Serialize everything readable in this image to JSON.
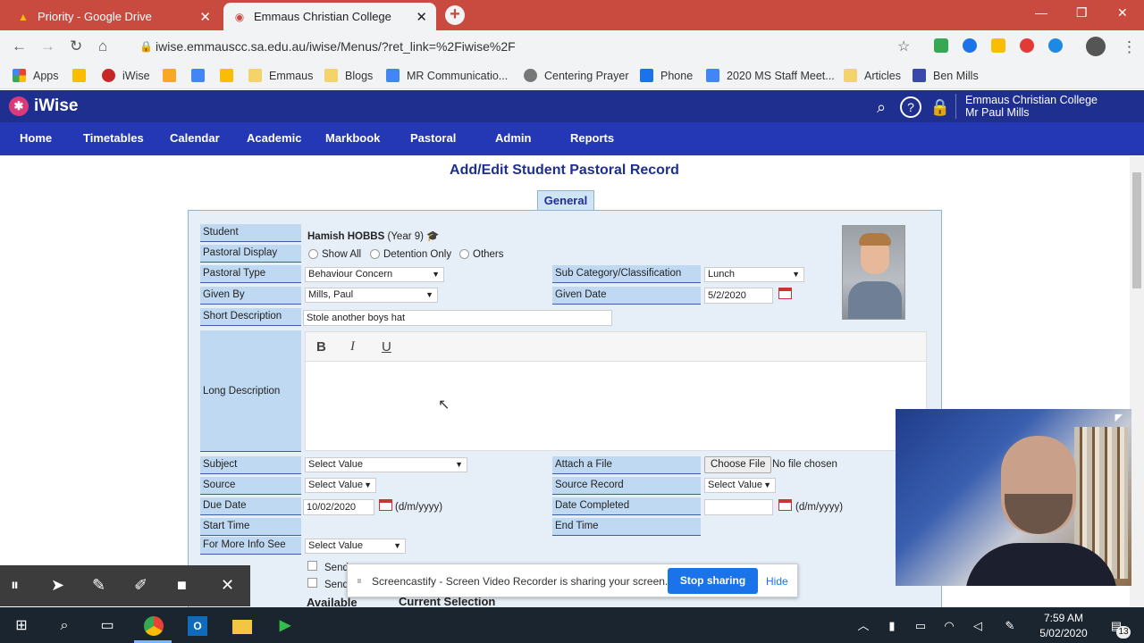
{
  "browser": {
    "tabs": [
      {
        "title": "Priority - Google Drive",
        "icon": "drive-icon"
      },
      {
        "title": "Emmaus Christian College",
        "icon": "globe-icon"
      }
    ],
    "url": "iwise.emmauscc.sa.edu.au/iwise/Menus/?ret_link=%2Fiwise%2F",
    "bookmarks": [
      "Apps",
      "",
      "iWise",
      "",
      "",
      "",
      "Emmaus",
      "Blogs",
      "MR Communicatio...",
      "Centering Prayer",
      "Phone",
      "2020 MS Staff Meet...",
      "Articles",
      "Ben Mills"
    ]
  },
  "app": {
    "logo": "iWise",
    "school": "Emmaus Christian College",
    "user": "Mr Paul Mills",
    "menu": [
      "Home",
      "Timetables",
      "Calendar",
      "Academic",
      "Markbook",
      "Pastoral",
      "Admin",
      "Reports"
    ]
  },
  "page": {
    "title": "Add/Edit Student Pastoral Record",
    "tab": "General"
  },
  "form": {
    "student_label": "Student",
    "student_name": "Hamish HOBBS",
    "student_year": "(Year 9)",
    "pastoral_display_label": "Pastoral Display",
    "display_options": [
      "Show All",
      "Detention Only",
      "Others"
    ],
    "pastoral_type_label": "Pastoral Type",
    "pastoral_type": "Behaviour Concern",
    "subcat_label": "Sub Category/Classification",
    "subcat": "Lunch",
    "given_by_label": "Given By",
    "given_by": "Mills, Paul",
    "given_date_label": "Given Date",
    "given_date": "5/2/2020",
    "short_desc_label": "Short Description",
    "short_desc": "Stole another boys hat",
    "long_desc_label": "Long Description",
    "editor_buttons": [
      "B",
      "I",
      "U"
    ],
    "subject_label": "Subject",
    "subject": "Select Value",
    "attach_label": "Attach a File",
    "choose_file": "Choose File",
    "no_file": "No file chosen",
    "source_label": "Source",
    "source": "Select Value",
    "source_record_label": "Source Record",
    "source_record": "Select Value",
    "due_date_label": "Due Date",
    "due_date": "10/02/2020",
    "date_format": "(d/m/yyyy)",
    "date_completed_label": "Date Completed",
    "start_time_label": "Start Time",
    "end_time_label": "End Time",
    "more_info_label": "For More Info See",
    "more_info": "Select Value",
    "send1": "Send",
    "send2": "Send",
    "available": "Available",
    "current_selection": "Current Selection"
  },
  "share": {
    "message": "Screencastify - Screen Video Recorder is sharing your screen.",
    "stop": "Stop sharing",
    "hide": "Hide"
  },
  "taskbar": {
    "time": "7:59 AM",
    "date": "5/02/2020",
    "notif_count": "13"
  }
}
